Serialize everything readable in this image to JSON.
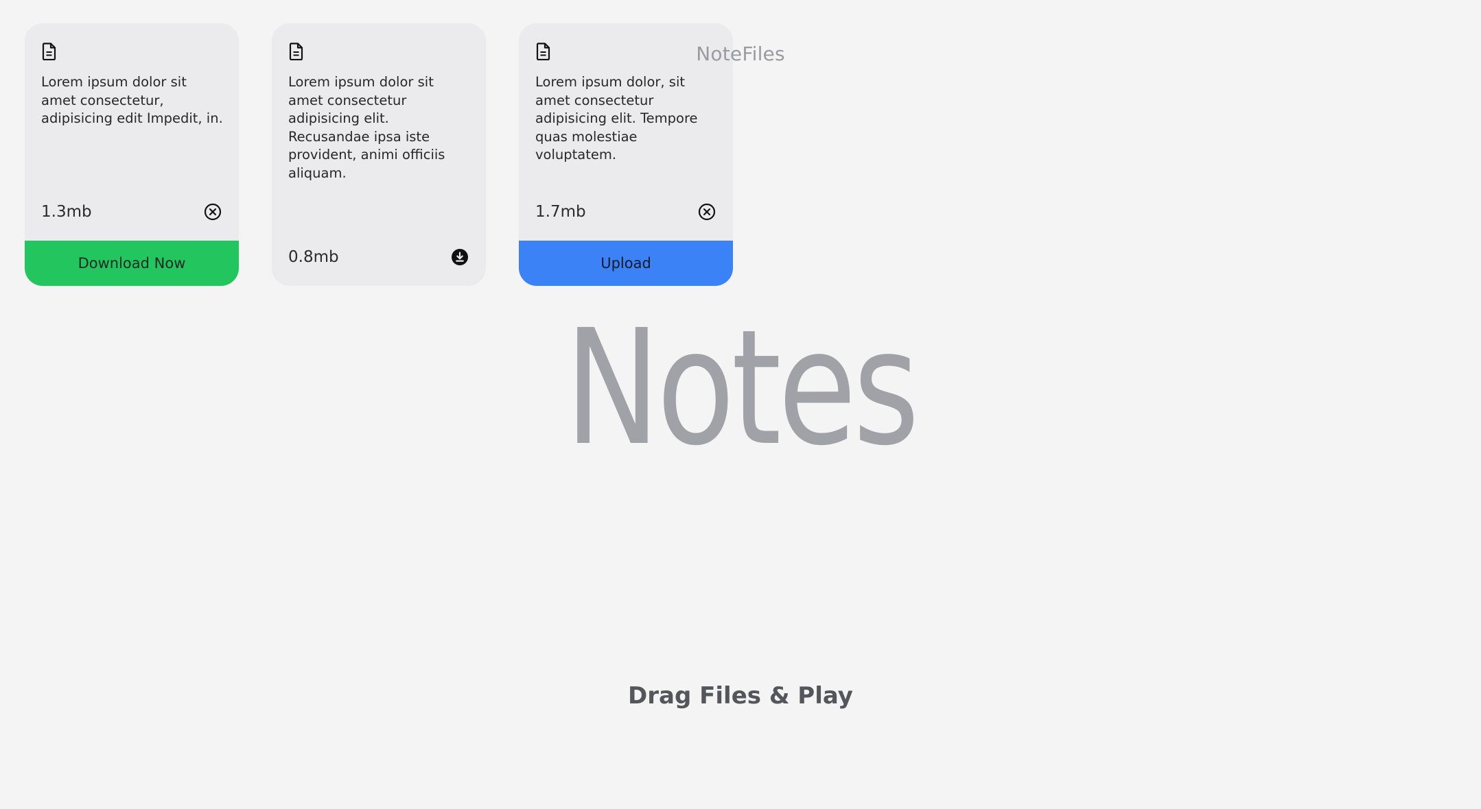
{
  "header": {
    "app_title": "NoteFiles",
    "hero_title": "Notes",
    "subtitle": "Drag Files & Play"
  },
  "cards": [
    {
      "description": "Lorem ipsum dolor sit amet consectetur, adipisicing edit Impedit, in.",
      "size": "1.3mb",
      "action_icon": "close-circle-icon",
      "button_label": "Download Now",
      "button_color": "#22c55e"
    },
    {
      "description": "Lorem ipsum dolor sit amet consectetur adipisicing elit. Recusandae ipsa iste provident, animi officiis aliquam.",
      "size": "0.8mb",
      "action_icon": "download-icon"
    },
    {
      "description": "Lorem ipsum dolor, sit amet consectetur adipisicing elit. Tempore quas molestiae voluptatem.",
      "size": "1.7mb",
      "action_icon": "close-circle-icon",
      "button_label": "Upload",
      "button_color": "#3b82f6"
    }
  ],
  "colors": {
    "background": "#f4f4f4",
    "card": "#ebebed",
    "accent_green": "#22c55e",
    "accent_blue": "#3b82f6"
  }
}
